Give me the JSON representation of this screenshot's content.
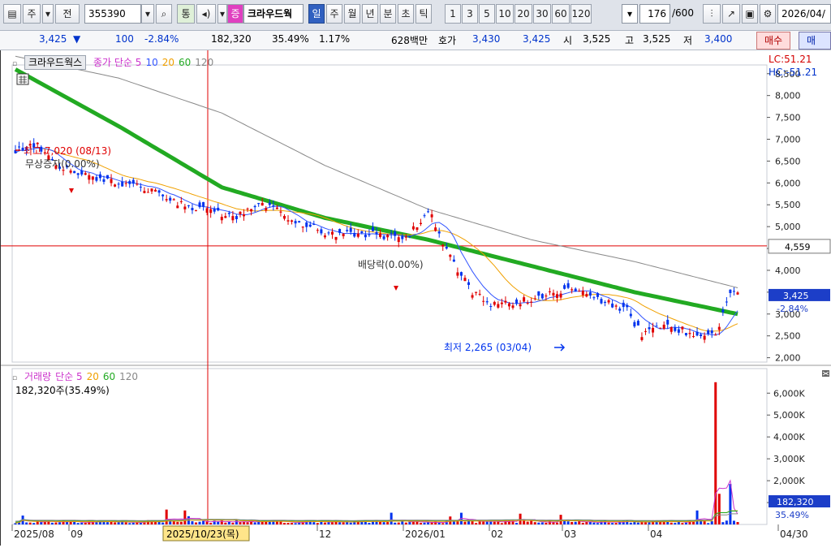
{
  "toolbar": {
    "mode": "주",
    "prev": "전",
    "code": "355390",
    "tong": "통",
    "jeung": "증",
    "name": "크라우드웍",
    "periods": [
      "일",
      "주",
      "월",
      "년",
      "분",
      "초",
      "틱"
    ],
    "active_period": "일",
    "numbers": [
      "1",
      "3",
      "5",
      "10",
      "20",
      "30",
      "60",
      "120"
    ],
    "count": "176",
    "total": "/600",
    "date": "2026/04/"
  },
  "quote": {
    "price": "3,425",
    "arrow": "▼",
    "change": "100",
    "rate": "-2.84%",
    "volume": "182,320",
    "vol_ratio": "35.49%",
    "turnover": "1.17%",
    "amount": "628백만",
    "hoga_label": "호가",
    "ask": "3,430",
    "bid": "3,425",
    "open_label": "시",
    "open": "3,525",
    "high_label": "고",
    "high": "3,525",
    "low_label": "저",
    "low": "3,400",
    "buy": "매수",
    "sell": "매도"
  },
  "price_panel": {
    "stock_label": "크라우드웍스",
    "ma_legend": [
      {
        "text": "종가 단순 5",
        "color": "#cc33cc"
      },
      {
        "text": "10",
        "color": "#3355ff"
      },
      {
        "text": "20",
        "color": "#f0a000"
      },
      {
        "text": "60",
        "color": "#22aa22"
      },
      {
        "text": "120",
        "color": "#888888"
      }
    ],
    "lc": "LC:51.21",
    "hc": "HC:-51.21",
    "high_marker": "최고 7,020 (08/13)",
    "event1": "무상증자(0.00%)",
    "event2": "배당락(0.00%)",
    "low_marker": "최저 2,265 (03/04)",
    "crosshair_value": "4,559",
    "last_price": "3,425",
    "last_rate": "-2.84%",
    "y_ticks": [
      "8,500",
      "8,000",
      "7,500",
      "7,000",
      "6,500",
      "6,000",
      "5,500",
      "5,000",
      "4,500",
      "4,000",
      "3,500",
      "3,000",
      "2,500",
      "2,000"
    ]
  },
  "volume_panel": {
    "legend": [
      {
        "text": "거래량",
        "color": "#cc33cc"
      },
      {
        "text": "단순 5",
        "color": "#cc33cc"
      },
      {
        "text": "20",
        "color": "#f0a000"
      },
      {
        "text": "60",
        "color": "#22aa22"
      },
      {
        "text": "120",
        "color": "#888888"
      }
    ],
    "current": "182,320주(35.49%)",
    "last_volume": "182,320",
    "last_ratio": "35.49%",
    "y_ticks": [
      "6,000K",
      "5,000K",
      "4,000K",
      "3,000K",
      "2,000K",
      "1,000K"
    ]
  },
  "x_axis": {
    "labels": [
      "2025/08",
      "09",
      "12",
      "2026/01",
      "02",
      "03",
      "04",
      "04/30"
    ],
    "crosshair_date": "2025/10/23(목)"
  },
  "colors": {
    "up": "#e00000",
    "down": "#0033ee",
    "ma5": "#cc33cc",
    "ma10": "#3355ff",
    "ma20": "#f0a000",
    "ma60": "#22aa22",
    "ma120": "#888888"
  },
  "chart_data": {
    "type": "line",
    "x": [
      "2025/08",
      "2025/09",
      "2025/10/23",
      "2025/12",
      "2026/01",
      "2026/02",
      "2026/03",
      "2026/04"
    ],
    "series": [
      {
        "name": "60",
        "values": [
          8600,
          7300,
          5900,
          5200,
          4700,
          4100,
          3500,
          3000
        ]
      },
      {
        "name": "120",
        "values": [
          8900,
          8400,
          7600,
          6400,
          5400,
          4700,
          4200,
          3600
        ]
      }
    ],
    "close": [
      6800,
      6000,
      5200,
      4800,
      3200,
      3300,
      2400,
      3425
    ],
    "ylim": [
      1900,
      8700
    ]
  }
}
